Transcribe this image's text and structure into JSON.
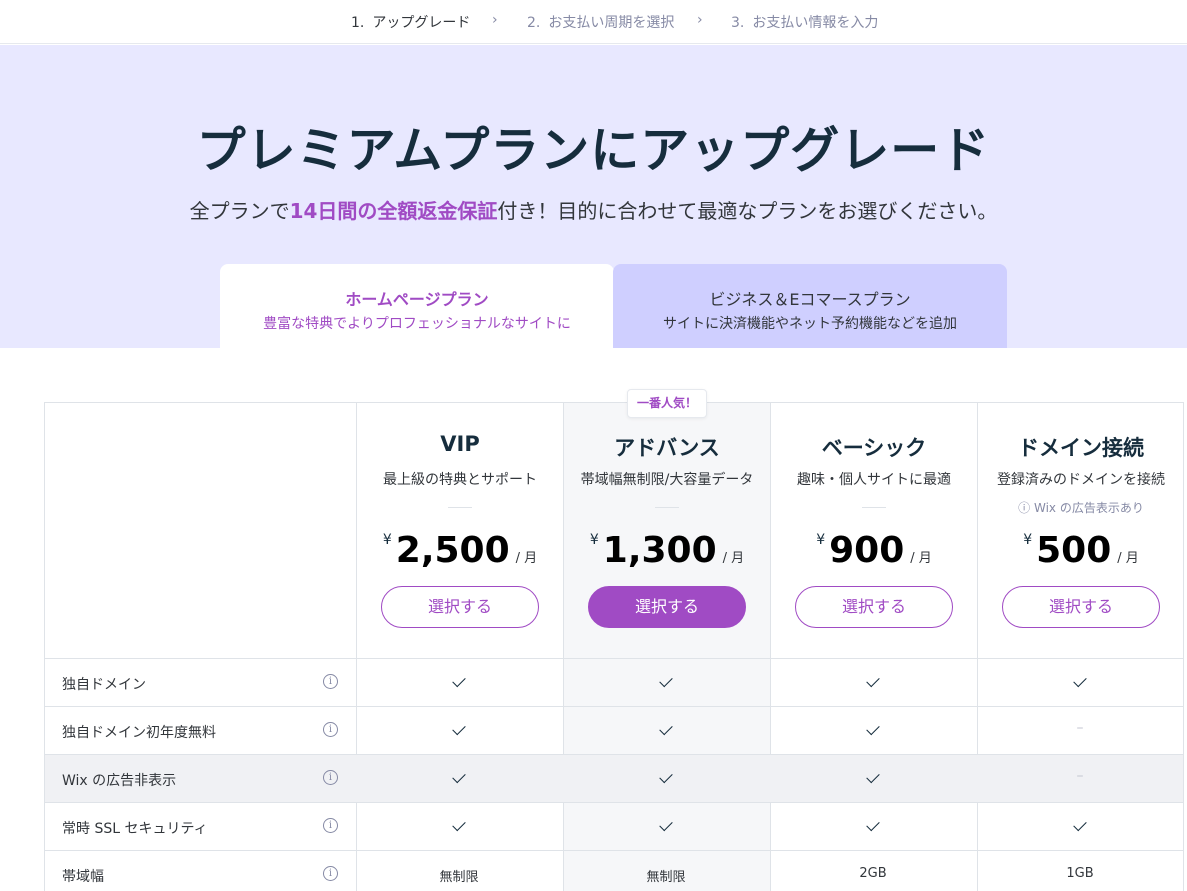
{
  "steps": [
    {
      "num": "1.",
      "label": "アップグレード"
    },
    {
      "num": "2.",
      "label": "お支払い周期を選択"
    },
    {
      "num": "3.",
      "label": "お支払い情報を入力"
    }
  ],
  "step_separator": "›",
  "hero": {
    "title": "プレミアムプランにアップグレード",
    "subtitle_pre": "全プランで",
    "subtitle_highlight": "14日間の全額返金保証",
    "subtitle_post": "付き！目的に合わせて最適なプランをお選びください。"
  },
  "tabs": [
    {
      "title": "ホームページプラン",
      "subtitle": "豊富な特典でよりプロフェッショナルなサイトに"
    },
    {
      "title": "ビジネス＆Eコマースプラン",
      "subtitle": "サイトに決済機能やネット予約機能などを追加"
    }
  ],
  "popular_badge": "一番人気！",
  "currency": "¥",
  "per_month": "/ 月",
  "plans": [
    {
      "name": "VIP",
      "desc": "最上級の特典とサポート",
      "price": "2,500",
      "button": "選択する"
    },
    {
      "name": "アドバンス",
      "desc": "帯域幅無制限/大容量データ",
      "price": "1,300",
      "button": "選択する"
    },
    {
      "name": "ベーシック",
      "desc": "趣味・個人サイトに最適",
      "price": "900",
      "button": "選択する"
    },
    {
      "name": "ドメイン接続",
      "desc": "登録済みのドメインを接続",
      "note": "ⓘ Wix の広告表示あり",
      "price": "500",
      "button": "選択する"
    }
  ],
  "features": [
    {
      "label": "独自ドメイン",
      "values": [
        "check",
        "check",
        "check",
        "check"
      ]
    },
    {
      "label": "独自ドメイン初年度無料",
      "values": [
        "check",
        "check",
        "check",
        "–"
      ]
    },
    {
      "label": "Wix の広告非表示",
      "values": [
        "check",
        "check",
        "check",
        "–"
      ]
    },
    {
      "label": "常時 SSL セキュリティ",
      "values": [
        "check",
        "check",
        "check",
        "check"
      ]
    },
    {
      "label": "帯域幅",
      "values": [
        "無制限",
        "無制限",
        "2GB",
        "1GB"
      ]
    }
  ],
  "colors": {
    "accent": "#a04bc4",
    "hero_bg": "#e8e8ff",
    "tab_inactive": "#cfcfff"
  }
}
